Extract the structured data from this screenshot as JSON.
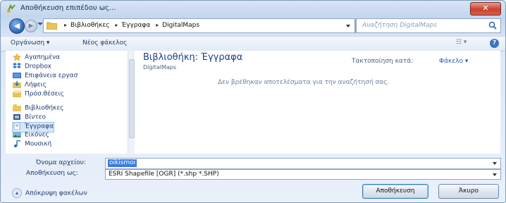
{
  "window": {
    "title": "Αποθήκευση επιπέδου ως...",
    "close_glyph": "✕"
  },
  "nav": {
    "back_glyph": "◀",
    "forward_glyph": "▶",
    "breadcrumbs": [
      "Βιβλιοθήκες",
      "Έγγραφα",
      "DigitalMaps"
    ],
    "crumb_separator": "▸",
    "refresh_glyph": "↻",
    "search_placeholder": "Αναζήτηση DigitalMaps"
  },
  "toolbar": {
    "organize_label": "Οργάνωση ▾",
    "new_folder_label": "Νέος φάκελος",
    "views_glyph": "☷ ▾",
    "help_glyph": "?"
  },
  "sidebar": {
    "items": [
      {
        "label": "Αγαπημένα",
        "icon": "star-icon"
      },
      {
        "label": "Dropbox",
        "icon": "dropbox-icon"
      },
      {
        "label": "Επιφάνεια εργασ",
        "icon": "desktop-icon"
      },
      {
        "label": "Λήψεις",
        "icon": "downloads-icon"
      },
      {
        "label": "Πρόσ.θέσεις",
        "icon": "recent-places-icon"
      },
      {
        "label": "Βιβλιοθήκες",
        "icon": "libraries-icon"
      },
      {
        "label": "Βίντεο",
        "icon": "video-icon"
      },
      {
        "label": "Έγγραφα",
        "icon": "documents-icon"
      },
      {
        "label": "Εικόνες",
        "icon": "pictures-icon"
      },
      {
        "label": "Μουσική",
        "icon": "music-icon"
      }
    ]
  },
  "content": {
    "library_title": "Βιβλιοθήκη: Έγγραφα",
    "library_subtitle": "DigitalMaps",
    "arrange_label": "Τακτοποίηση κατά:",
    "arrange_value": "Φάκελο ▾",
    "empty_message": "Δεν βρέθηκαν αποτελέσματα για την αναζήτησή σας."
  },
  "form": {
    "filename_label": "Όνομα αρχείου:",
    "filename_value": "oikismoi",
    "filetype_label": "Αποθήκευση ως:",
    "filetype_value": "ESRI Shapefile [OGR] (*.shp *.SHP)"
  },
  "footer": {
    "hide_folders_label": "Απόκρυψη φακέλων",
    "hide_folders_glyph": "▴",
    "save_label": "Αποθήκευση",
    "cancel_label": "Άκυρο"
  }
}
